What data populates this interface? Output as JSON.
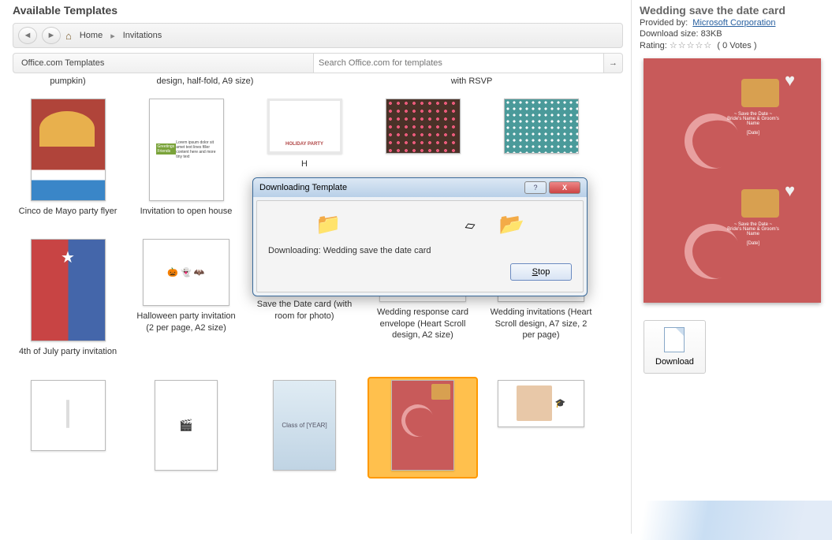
{
  "header": "Available Templates",
  "breadcrumb": {
    "home": "Home",
    "current": "Invitations"
  },
  "section_label": "Office.com Templates",
  "search": {
    "placeholder": "Search Office.com for templates"
  },
  "partial_row": {
    "c1": "pumpkin)",
    "c2": "design, half-fold, A9 size)",
    "c4": "with RSVP"
  },
  "templates": {
    "r1": [
      {
        "label": "Cinco de Mayo party flyer"
      },
      {
        "label": "Invitation to open house"
      },
      {
        "label": "H"
      },
      {
        "label": ""
      },
      {
        "label": ""
      }
    ],
    "r2": [
      {
        "label": "4th of July party invitation"
      },
      {
        "label": "Halloween party invitation (2 per page, A2 size)"
      },
      {
        "label": "Save the Date card (with room for photo)"
      },
      {
        "label": "Wedding response card envelope (Heart Scroll design, A2 size)"
      },
      {
        "label": "Wedding invitations (Heart Scroll design, A7 size, 2 per page)"
      }
    ],
    "r3_classof": "Class of\n[YEAR]"
  },
  "dialog": {
    "title": "Downloading Template",
    "message": "Downloading: Wedding save the date card",
    "stop": "Stop"
  },
  "details": {
    "title": "Wedding save the date card",
    "provided_label": "Provided by:",
    "provider": "Microsoft Corporation",
    "size_label": "Download size:",
    "size": "83KB",
    "rating_label": "Rating:",
    "votes": "( 0 Votes )",
    "download": "Download",
    "preview_save": "~ Save the Date ~",
    "preview_line1": "Bride's Name & Groom's Name",
    "preview_line2": "[Date]"
  }
}
